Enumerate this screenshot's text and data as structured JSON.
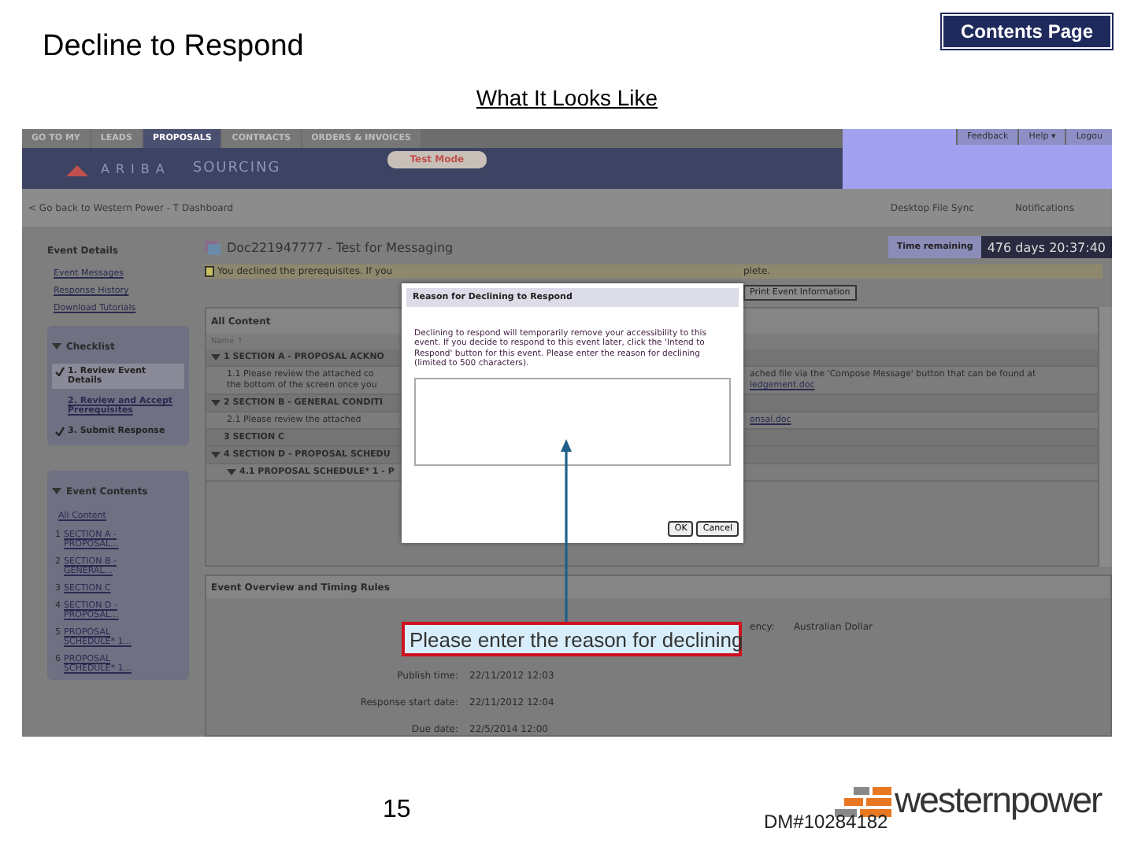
{
  "slide": {
    "title": "Decline to Respond",
    "contents_button": "Contents Page",
    "subtitle": "What It Looks Like",
    "page_number": "15",
    "document_id": "DM#10284182",
    "logo_text": "westernpower"
  },
  "app": {
    "nav_tabs": [
      {
        "label": "GO TO MY",
        "selected": false
      },
      {
        "label": "LEADS",
        "selected": false
      },
      {
        "label": "PROPOSALS",
        "selected": true
      },
      {
        "label": "CONTRACTS",
        "selected": false
      },
      {
        "label": "ORDERS & INVOICES",
        "selected": false
      }
    ],
    "logo": {
      "brand": "ARIBA",
      "product": "SOURCING"
    },
    "mode_badge": "Test Mode",
    "header_links": [
      "Feedback",
      "Help ▾",
      "Logou"
    ],
    "back_link": "< Go back to Western Power - T Dashboard",
    "top_links": [
      "Desktop File Sync",
      "Notifications"
    ],
    "sidebar": {
      "details_title": "Event Details",
      "links": [
        "Event Messages",
        "Response History",
        "Download Tutorials"
      ],
      "checklist_title": "Checklist",
      "checklist": [
        {
          "label": "1. Review Event Details",
          "checked": true,
          "selected": true
        },
        {
          "label": "2. Review and Accept Prerequisites",
          "checked": false,
          "selected": false
        },
        {
          "label": "3. Submit Response",
          "checked": true,
          "selected": false
        }
      ],
      "contents_title": "Event Contents",
      "contents_all": "All Content",
      "contents": [
        {
          "number": "1",
          "label": "SECTION A - PROPOSAL..."
        },
        {
          "number": "2",
          "label": "SECTION B - GENERAL..."
        },
        {
          "number": "3",
          "label": "SECTION C"
        },
        {
          "number": "4",
          "label": "SECTION D - PROPOSAL..."
        },
        {
          "number": "5",
          "label": "PROPOSAL SCHEDULE* 1..."
        },
        {
          "number": "6",
          "label": "PROPOSAL SCHEDULE* 1..."
        }
      ]
    },
    "event_title": "Doc221947777 - Test for Messaging",
    "time_remaining_label": "Time remaining",
    "time_remaining": "476 days 20:37:40",
    "notice": {
      "left": "You declined the prerequisites. If you",
      "right": "plete."
    },
    "print_button": "Print Event Information",
    "content_panel": {
      "title": "All Content",
      "sort_column": "Name ↑",
      "rows": [
        {
          "kind": "section",
          "expanded": true,
          "left": "1  SECTION A - PROPOSAL ACKNO"
        },
        {
          "kind": "item",
          "left": "1.1  Please review the attached co",
          "left2": "the bottom of the screen once you",
          "right": "ached file via the 'Compose Message' button that can be found at",
          "right_link": "ledgement.doc"
        },
        {
          "kind": "section",
          "expanded": true,
          "left": "2  SECTION B - GENERAL CONDITI"
        },
        {
          "kind": "item",
          "left": "2.1  Please review the attached",
          "right_link": "onsal.doc"
        },
        {
          "kind": "section",
          "expanded": false,
          "left": "3  SECTION C"
        },
        {
          "kind": "section",
          "expanded": true,
          "left": "4  SECTION D - PROPOSAL SCHEDU"
        },
        {
          "kind": "subsection",
          "expanded": true,
          "left": "4.1  PROPOSAL SCHEDULE* 1 - P"
        }
      ]
    },
    "overview": {
      "title": "Event Overview and Timing Rules",
      "currency": {
        "label": "ency:",
        "value": "Australian Dollar"
      },
      "dates": [
        {
          "label": "Publish time:",
          "value": "22/11/2012 12:03"
        },
        {
          "label": "Response start date:",
          "value": "22/11/2012 12:04"
        },
        {
          "label": "Due date:",
          "value": "22/5/2014 12:00"
        }
      ]
    },
    "dialog": {
      "title": "Reason for Declining to Respond",
      "message": "Declining to respond will temporarily remove your accessibility to this event. If you decide to respond to this event later, click the 'Intend to Respond' button for this event. Please enter the reason for declining (limited to 500 characters).",
      "ok": "OK",
      "cancel": "Cancel"
    },
    "callout": "Please enter the reason for declining"
  }
}
